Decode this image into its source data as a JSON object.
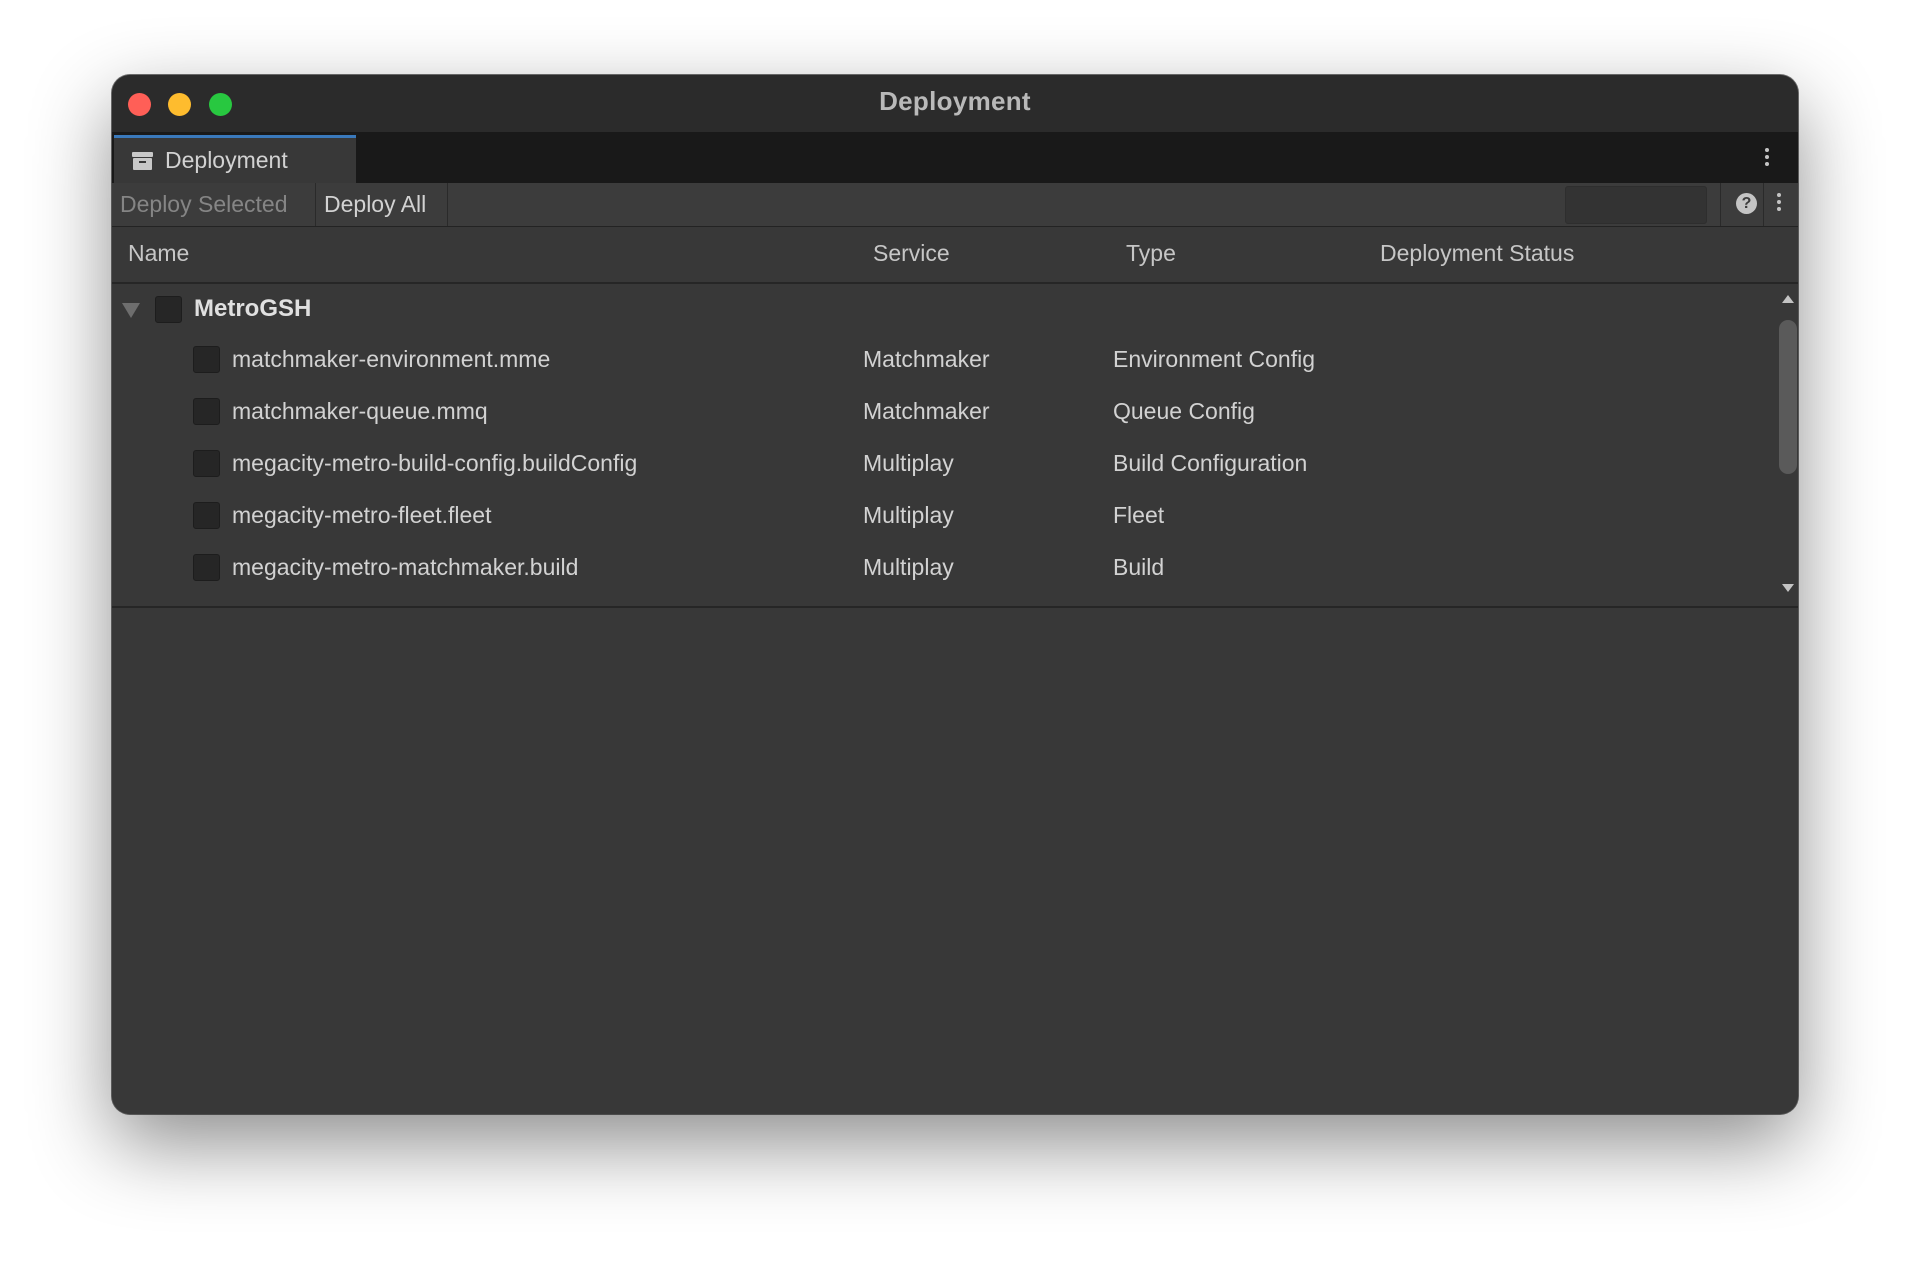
{
  "window": {
    "title": "Deployment"
  },
  "tab": {
    "label": "Deployment",
    "icon": "archive-box-icon"
  },
  "toolbar": {
    "deploy_selected_label": "Deploy Selected",
    "deploy_all_label": "Deploy All",
    "search_value": "",
    "help_glyph": "?"
  },
  "table": {
    "columns": {
      "name": "Name",
      "service": "Service",
      "type": "Type",
      "status": "Deployment Status"
    },
    "group": {
      "label": "MetroGSH",
      "expanded": true,
      "checked": false
    },
    "rows": [
      {
        "name": "matchmaker-environment.mme",
        "service": "Matchmaker",
        "type": "Environment Config",
        "status": ""
      },
      {
        "name": "matchmaker-queue.mmq",
        "service": "Matchmaker",
        "type": "Queue Config",
        "status": ""
      },
      {
        "name": "megacity-metro-build-config.buildConfig",
        "service": "Multiplay",
        "type": "Build Configuration",
        "status": ""
      },
      {
        "name": "megacity-metro-fleet.fleet",
        "service": "Multiplay",
        "type": "Fleet",
        "status": ""
      },
      {
        "name": "megacity-metro-matchmaker.build",
        "service": "Multiplay",
        "type": "Build",
        "status": ""
      }
    ]
  },
  "colors": {
    "accent_tab": "#3a79bb",
    "close": "#ff5f57",
    "minimize": "#febc2e",
    "maximize": "#28c840"
  }
}
